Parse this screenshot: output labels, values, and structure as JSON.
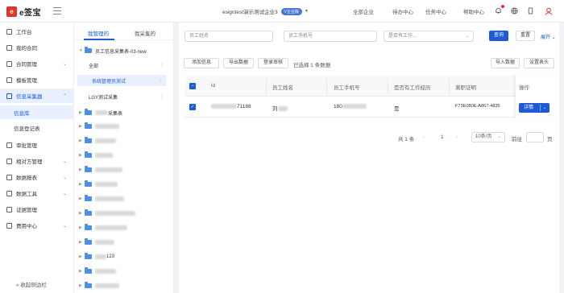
{
  "header": {
    "logo_mark": "e",
    "logo_text": "e签宝",
    "company": "esigntest演示测试企业3",
    "vip": "V企业版",
    "nav": [
      "全部企业",
      "待办中心",
      "任务中心",
      "帮助中心"
    ]
  },
  "sidebar": {
    "items": [
      {
        "label": "工作台"
      },
      {
        "label": "我的合同"
      },
      {
        "label": "合同管理"
      },
      {
        "label": "模板管理"
      },
      {
        "label": "信息采集器"
      },
      {
        "label": "信息库"
      },
      {
        "label": "信息登记表"
      },
      {
        "label": "审批管理"
      },
      {
        "label": "相对方管理"
      },
      {
        "label": "数据报表"
      },
      {
        "label": "数据工具"
      },
      {
        "label": "证据管理"
      },
      {
        "label": "费用中心"
      }
    ],
    "collapse_label": "收起侧边栏"
  },
  "tree": {
    "tabs": [
      "我管理的",
      "我采集的"
    ],
    "root": "员工信息采集表-03-new",
    "children": [
      "全部",
      "系统管理员测试",
      "LGY测试采集"
    ],
    "folders": [
      "采集表",
      "",
      "",
      "",
      "",
      "",
      "",
      "",
      "123",
      ""
    ]
  },
  "filters": {
    "name_placeholder": "员工姓名",
    "phone_placeholder": "员工手机号",
    "history_placeholder": "是否有工作...",
    "query_label": "查询",
    "reset_label": "重置",
    "expand_label": "展开"
  },
  "toolbar": {
    "buttons": [
      "添加信息",
      "导出数据",
      "登录审核"
    ],
    "selected_text": "已选择 1 条数据",
    "import_label": "导入数据",
    "settings_label": "设置表头"
  },
  "table": {
    "headers": [
      "id",
      "员工姓名",
      "员工手机号",
      "是否有工作经历",
      "离职证明",
      "操作"
    ],
    "row": {
      "id": "71188",
      "name": "刘",
      "phone": "180",
      "has_experience": "是",
      "proof": "F73E080E-A867-4835",
      "action": "详情"
    }
  },
  "pagination": {
    "total": "共 1 条",
    "current_page": "1",
    "page_size": "10条/页",
    "goto_label": "前往",
    "page_unit": "页"
  }
}
